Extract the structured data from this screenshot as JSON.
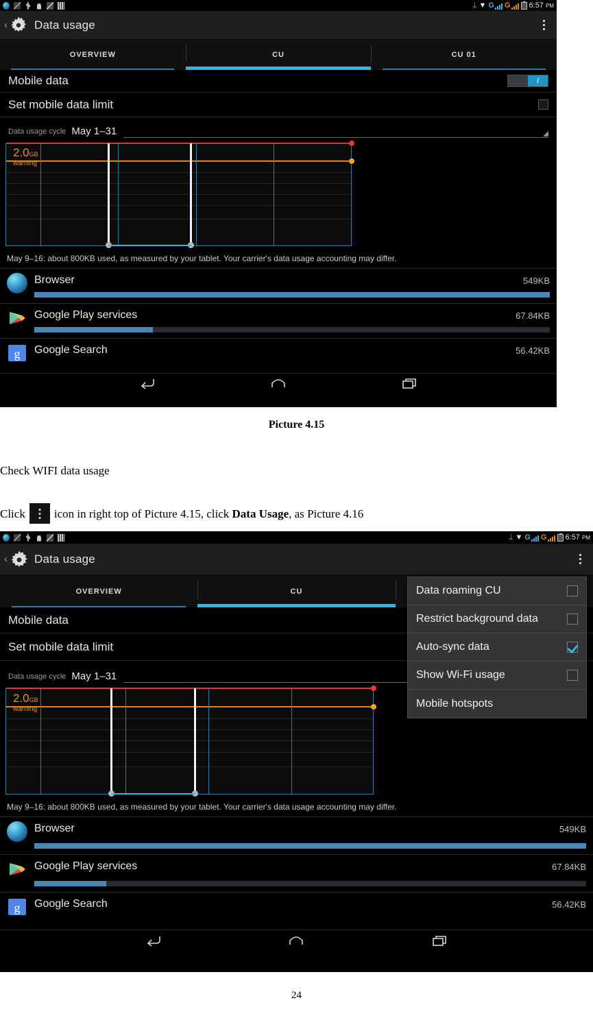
{
  "document": {
    "caption_1": "Picture 4.15",
    "paragraph_1": "Check WIFI data usage",
    "click_prefix": "Click",
    "click_middle": "icon in right top of Picture 4.15, click",
    "click_bold": "Data Usage",
    "click_suffix": ", as Picture 4.16",
    "page_number": "24"
  },
  "screenshot1": {
    "statusbar": {
      "left_icons": [
        "browser-icon",
        "image-icon",
        "usb-icon",
        "lock-icon",
        "sdcard-icon",
        "bars-icon"
      ],
      "bluetooth": "ᛦ",
      "wifi": "▼",
      "signal_1_label": "G",
      "signal_2_label": "G",
      "time": "6:57",
      "meridiem": "PM"
    },
    "actionbar": {
      "back": "‹",
      "icon": "settings-gear-icon",
      "title": "Data usage",
      "overflow": "overflow-menu-icon"
    },
    "tabs": [
      {
        "label": "OVERVIEW",
        "active": false
      },
      {
        "label": "CU",
        "active": true
      },
      {
        "label": "CU 01",
        "active": false
      }
    ],
    "settings": {
      "mobile_data_label": "Mobile data",
      "mobile_data_on": "I",
      "set_limit_label": "Set mobile data limit",
      "cycle_label": "Data usage cycle",
      "cycle_value": "May 1–31"
    },
    "chart": {
      "warning_value": "2.0",
      "warning_unit": "GB",
      "warning_label": "warning"
    },
    "note": "May 9–16: about 800KB used, as measured by your tablet. Your carrier's data usage accounting may differ.",
    "apps": [
      {
        "name": "Browser",
        "usage": "549KB",
        "bar_pct": 100,
        "icon": "browser-globe-icon"
      },
      {
        "name": "Google Play services",
        "usage": "67.84KB",
        "bar_pct": 23,
        "icon": "google-play-icon"
      },
      {
        "name": "Google Search",
        "usage": "56.42KB",
        "bar_pct": 0,
        "icon": "google-search-icon"
      }
    ],
    "navbar": [
      "back-nav-icon",
      "home-nav-icon",
      "recents-nav-icon"
    ]
  },
  "screenshot2": {
    "statusbar": {
      "signal_1_label": "G",
      "signal_2_label": "G",
      "time": "6:57",
      "meridiem": "PM"
    },
    "actionbar": {
      "back": "‹",
      "title": "Data usage"
    },
    "tabs": [
      {
        "label": "OVERVIEW",
        "active": false
      },
      {
        "label": "CU",
        "active": true
      },
      {
        "label": "",
        "active": false
      }
    ],
    "settings": {
      "mobile_data_label": "Mobile data",
      "set_limit_label": "Set mobile data limit",
      "cycle_label": "Data usage cycle",
      "cycle_value": "May 1–31"
    },
    "chart": {
      "warning_value": "2.0",
      "warning_unit": "GB",
      "warning_label": "warning"
    },
    "note": "May 9–16: about 800KB used, as measured by your tablet. Your carrier's data usage accounting may differ.",
    "apps": [
      {
        "name": "Browser",
        "usage": "549KB",
        "bar_pct": 100
      },
      {
        "name": "Google Play services",
        "usage": "67.84KB",
        "bar_pct": 13
      },
      {
        "name": "Google Search",
        "usage": "56.42KB",
        "bar_pct": 0
      }
    ],
    "menu": [
      {
        "label": "Data roaming CU",
        "checkbox": true,
        "checked": false
      },
      {
        "label": "Restrict background data",
        "checkbox": true,
        "checked": false
      },
      {
        "label": "Auto-sync data",
        "checkbox": true,
        "checked": true
      },
      {
        "label": "Show Wi-Fi usage",
        "checkbox": true,
        "checked": false
      },
      {
        "label": "Mobile hotspots",
        "checkbox": false,
        "checked": false
      }
    ]
  },
  "colors": {
    "accent_blue": "#33b5e5",
    "limit_red": "#e8392c",
    "warning_orange": "#f5a623",
    "bar_blue": "#4a86b6",
    "signal_blue": "#3fb0e0",
    "signal_orange": "#e8851f"
  }
}
